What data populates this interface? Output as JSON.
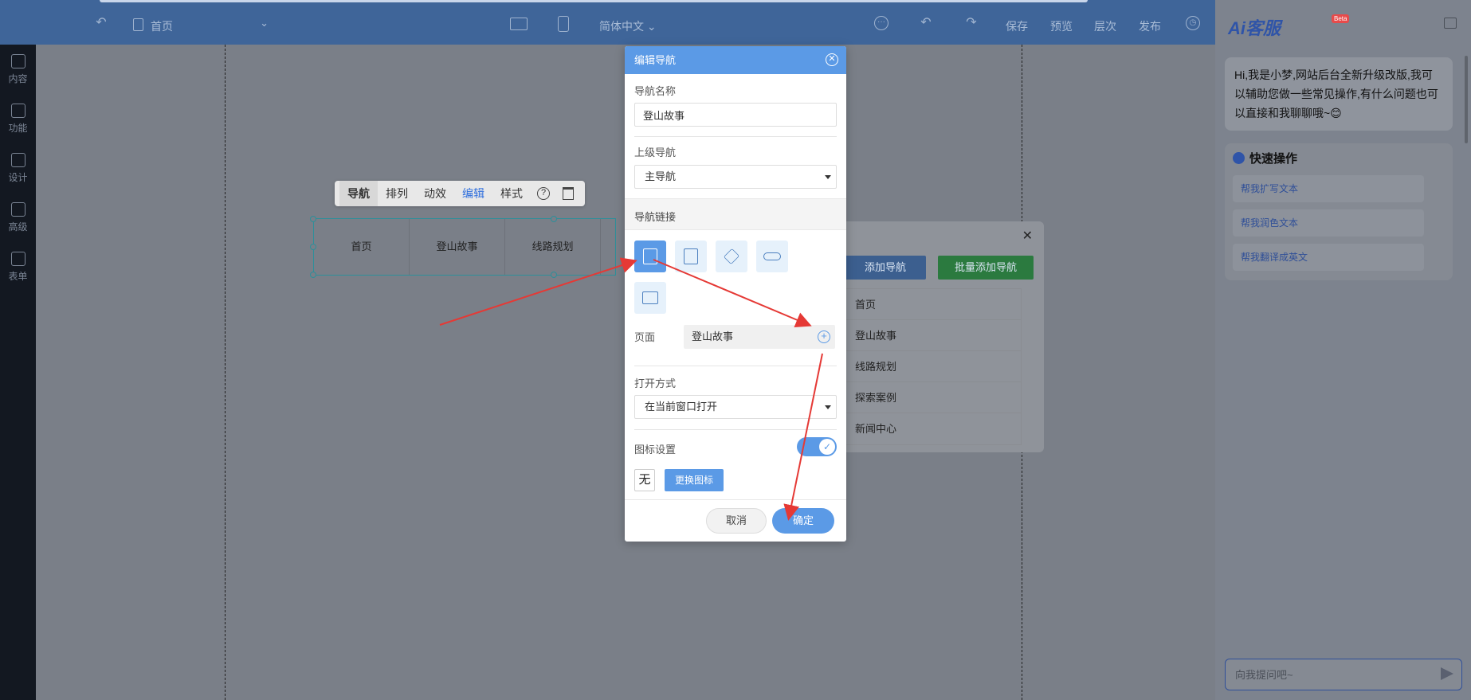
{
  "toolbar": {
    "page_name": "首页",
    "language": "简体中文",
    "save": "保存",
    "preview": "预览",
    "layers": "层次",
    "publish": "发布"
  },
  "left_sidebar": {
    "items": [
      {
        "label": "内容",
        "icon": "file-icon"
      },
      {
        "label": "功能",
        "icon": "grid-icon"
      },
      {
        "label": "设计",
        "icon": "layout-icon"
      },
      {
        "label": "高级",
        "icon": "code-icon"
      },
      {
        "label": "表单",
        "icon": "form-icon"
      }
    ]
  },
  "widget_toolbar": {
    "items": [
      "导航",
      "排列",
      "动效",
      "编辑",
      "样式"
    ],
    "help_glyph": "?"
  },
  "nav_preview": {
    "items": [
      "首页",
      "登山故事",
      "线路规划"
    ]
  },
  "bg_panel": {
    "add_nav": "添加导航",
    "batch_add_nav": "批量添加导航",
    "close_glyph": "✕",
    "items": [
      "首页",
      "登山故事",
      "线路规划",
      "探索案例",
      "新闻中心"
    ]
  },
  "dialog": {
    "title": "编辑导航",
    "nav_name_label": "导航名称",
    "nav_name_value": "登山故事",
    "parent_nav_label": "上级导航",
    "parent_nav_value": "主导航",
    "nav_link_label": "导航链接",
    "page_label": "页面",
    "page_value": "登山故事",
    "open_mode_label": "打开方式",
    "open_mode_value": "在当前窗口打开",
    "icon_setting_label": "图标设置",
    "icon_setting_enabled": true,
    "none_label": "无",
    "change_icon": "更换图标",
    "cancel": "取消",
    "confirm": "确定",
    "link_types": [
      "page-icon",
      "article-icon",
      "layers-icon",
      "link-icon",
      "list-icon"
    ],
    "selected_link_type": "page-icon"
  },
  "ai_panel": {
    "logo": "Ai客服",
    "badge": "Beta",
    "greeting": "Hi,我是小梦,网站后台全新升级改版,我可以辅助您做一些常见操作,有什么问题也可以直接和我聊聊哦~😊",
    "quick_title": "快速操作",
    "quick_actions": [
      "帮我扩写文本",
      "帮我润色文本",
      "帮我翻译成英文"
    ],
    "input_placeholder": "向我提问吧~"
  },
  "colors": {
    "accent": "#5b9ae6",
    "topbar": "#3f6599",
    "sidebar": "#131821",
    "annotation_arrow": "#e53935"
  }
}
